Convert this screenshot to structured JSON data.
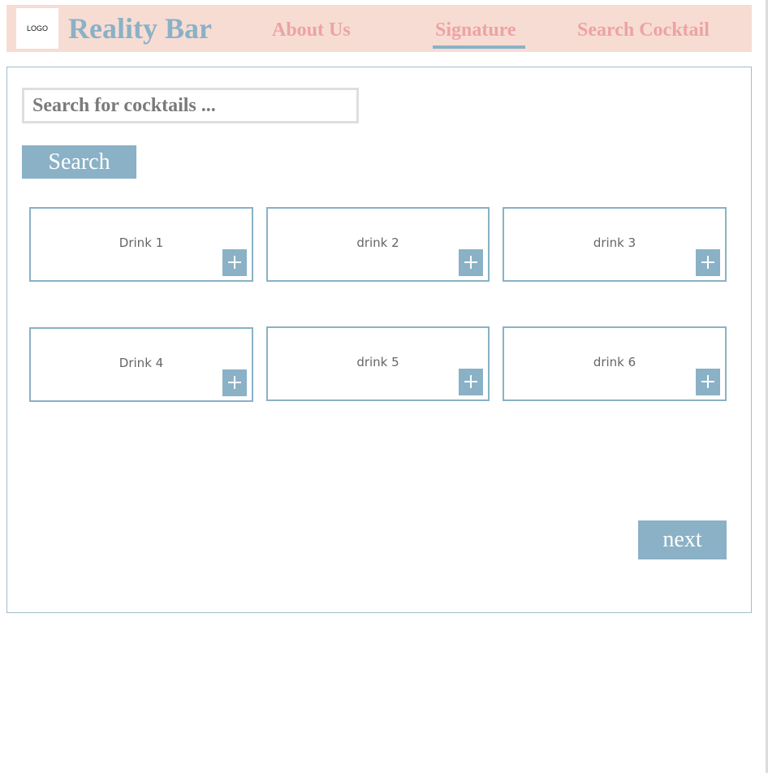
{
  "header": {
    "logo_text": "LOGO",
    "brand": "Reality Bar",
    "nav": {
      "about": "About Us",
      "signature": "Signature",
      "search": "Search Cocktail"
    },
    "active_nav": "Signature"
  },
  "search": {
    "placeholder": "Search for cocktails ...",
    "value": "",
    "button_label": "Search"
  },
  "drinks": [
    {
      "label": "Drink 1"
    },
    {
      "label": "drink 2"
    },
    {
      "label": "drink 3"
    },
    {
      "label": "Drink 4"
    },
    {
      "label": "drink 5"
    },
    {
      "label": "drink 6"
    }
  ],
  "pagination": {
    "next_label": "next"
  },
  "colors": {
    "header_bg": "#f7dcd4",
    "accent_blue": "#8ab1c6",
    "nav_pink": "#eca3a3",
    "panel_border": "#9fbfc4"
  },
  "icons": {
    "add": "plus-icon"
  }
}
